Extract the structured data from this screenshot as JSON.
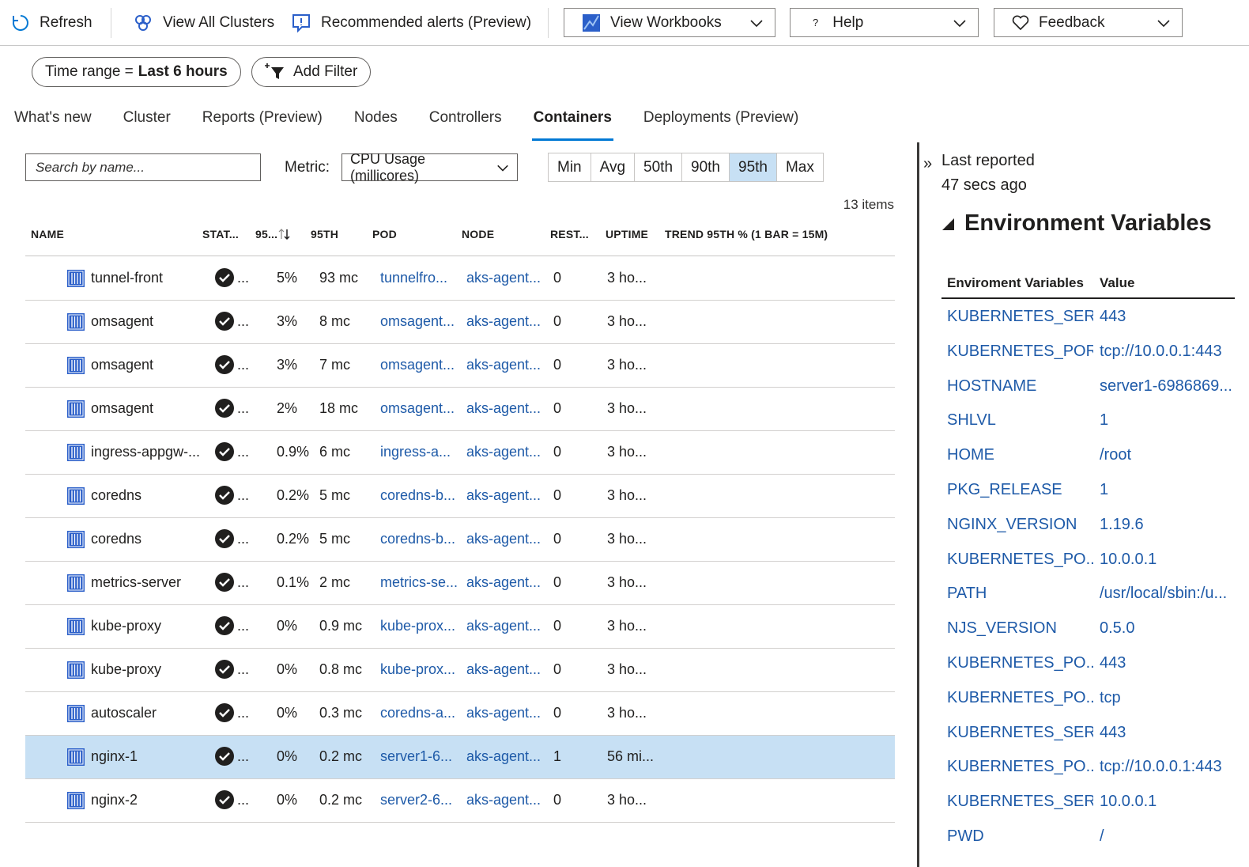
{
  "toolbar": {
    "refresh": "Refresh",
    "view_all_clusters": "View All Clusters",
    "recommended_alerts": "Recommended alerts (Preview)",
    "view_workbooks": "View Workbooks",
    "help": "Help",
    "feedback": "Feedback"
  },
  "filters": {
    "time_range_label": "Time range =",
    "time_range_value": "Last 6 hours",
    "add_filter": "Add Filter"
  },
  "tabs": [
    "What's new",
    "Cluster",
    "Reports (Preview)",
    "Nodes",
    "Controllers",
    "Containers",
    "Deployments (Preview)"
  ],
  "active_tab": "Containers",
  "controls": {
    "search_placeholder": "Search by name...",
    "metric_label": "Metric:",
    "metric_value": "CPU Usage (millicores)",
    "aggregations": [
      "Min",
      "Avg",
      "50th",
      "90th",
      "95th",
      "Max"
    ],
    "selected_aggregation": "95th",
    "item_count": "13 items"
  },
  "table": {
    "headers": {
      "name": "NAME",
      "status": "STAT...",
      "pct": "95...",
      "p95": "95TH",
      "pod": "POD",
      "node": "NODE",
      "restarts": "REST...",
      "uptime": "UPTIME",
      "trend": "TREND 95TH % (1 BAR = 15M)"
    },
    "rows": [
      {
        "name": "tunnel-front",
        "status": "...",
        "pct": "5%",
        "p95": "93 mc",
        "pod": "tunnelfro...",
        "node": "aks-agent...",
        "restarts": "0",
        "uptime": "3 ho...",
        "selected": false
      },
      {
        "name": "omsagent",
        "status": "...",
        "pct": "3%",
        "p95": "8 mc",
        "pod": "omsagent...",
        "node": "aks-agent...",
        "restarts": "0",
        "uptime": "3 ho...",
        "selected": false
      },
      {
        "name": "omsagent",
        "status": "...",
        "pct": "3%",
        "p95": "7 mc",
        "pod": "omsagent...",
        "node": "aks-agent...",
        "restarts": "0",
        "uptime": "3 ho...",
        "selected": false
      },
      {
        "name": "omsagent",
        "status": "...",
        "pct": "2%",
        "p95": "18 mc",
        "pod": "omsagent...",
        "node": "aks-agent...",
        "restarts": "0",
        "uptime": "3 ho...",
        "selected": false
      },
      {
        "name": "ingress-appgw-...",
        "status": "...",
        "pct": "0.9%",
        "p95": "6 mc",
        "pod": "ingress-a...",
        "node": "aks-agent...",
        "restarts": "0",
        "uptime": "3 ho...",
        "selected": false
      },
      {
        "name": "coredns",
        "status": "...",
        "pct": "0.2%",
        "p95": "5 mc",
        "pod": "coredns-b...",
        "node": "aks-agent...",
        "restarts": "0",
        "uptime": "3 ho...",
        "selected": false
      },
      {
        "name": "coredns",
        "status": "...",
        "pct": "0.2%",
        "p95": "5 mc",
        "pod": "coredns-b...",
        "node": "aks-agent...",
        "restarts": "0",
        "uptime": "3 ho...",
        "selected": false
      },
      {
        "name": "metrics-server",
        "status": "...",
        "pct": "0.1%",
        "p95": "2 mc",
        "pod": "metrics-se...",
        "node": "aks-agent...",
        "restarts": "0",
        "uptime": "3 ho...",
        "selected": false
      },
      {
        "name": "kube-proxy",
        "status": "...",
        "pct": "0%",
        "p95": "0.9 mc",
        "pod": "kube-prox...",
        "node": "aks-agent...",
        "restarts": "0",
        "uptime": "3 ho...",
        "selected": false
      },
      {
        "name": "kube-proxy",
        "status": "...",
        "pct": "0%",
        "p95": "0.8 mc",
        "pod": "kube-prox...",
        "node": "aks-agent...",
        "restarts": "0",
        "uptime": "3 ho...",
        "selected": false
      },
      {
        "name": "autoscaler",
        "status": "...",
        "pct": "0%",
        "p95": "0.3 mc",
        "pod": "coredns-a...",
        "node": "aks-agent...",
        "restarts": "0",
        "uptime": "3 ho...",
        "selected": false
      },
      {
        "name": "nginx-1",
        "status": "...",
        "pct": "0%",
        "p95": "0.2 mc",
        "pod": "server1-6...",
        "node": "aks-agent...",
        "restarts": "1",
        "uptime": "56 mi...",
        "selected": true
      },
      {
        "name": "nginx-2",
        "status": "...",
        "pct": "0%",
        "p95": "0.2 mc",
        "pod": "server2-6...",
        "node": "aks-agent...",
        "restarts": "0",
        "uptime": "3 ho...",
        "selected": false
      }
    ]
  },
  "panel": {
    "last_reported_line1": "Last reported",
    "last_reported_line2": "47 secs ago",
    "section_title": "Environment Variables",
    "col_name": "Enviroment Variables",
    "col_value": "Value",
    "env": [
      {
        "name": "KUBERNETES_SER...",
        "value": "443"
      },
      {
        "name": "KUBERNETES_PORT",
        "value": "tcp://10.0.0.1:443"
      },
      {
        "name": "HOSTNAME",
        "value": "server1-6986869..."
      },
      {
        "name": "SHLVL",
        "value": "1"
      },
      {
        "name": "HOME",
        "value": "/root"
      },
      {
        "name": "PKG_RELEASE",
        "value": "1"
      },
      {
        "name": "NGINX_VERSION",
        "value": "1.19.6"
      },
      {
        "name": "KUBERNETES_PO...",
        "value": "10.0.0.1"
      },
      {
        "name": "PATH",
        "value": "/usr/local/sbin:/u..."
      },
      {
        "name": "NJS_VERSION",
        "value": "0.5.0"
      },
      {
        "name": "KUBERNETES_PO...",
        "value": "443"
      },
      {
        "name": "KUBERNETES_PO...",
        "value": "tcp"
      },
      {
        "name": "KUBERNETES_SER...",
        "value": "443"
      },
      {
        "name": "KUBERNETES_PO...",
        "value": "tcp://10.0.0.1:443"
      },
      {
        "name": "KUBERNETES_SER...",
        "value": "10.0.0.1"
      },
      {
        "name": "PWD",
        "value": "/"
      }
    ]
  },
  "colors": {
    "accent": "#0078d4",
    "link": "#1e5aa8",
    "selected_row": "#c7e0f4",
    "container_icon": "#2b5fc9",
    "status_ok": "#201f1e"
  }
}
